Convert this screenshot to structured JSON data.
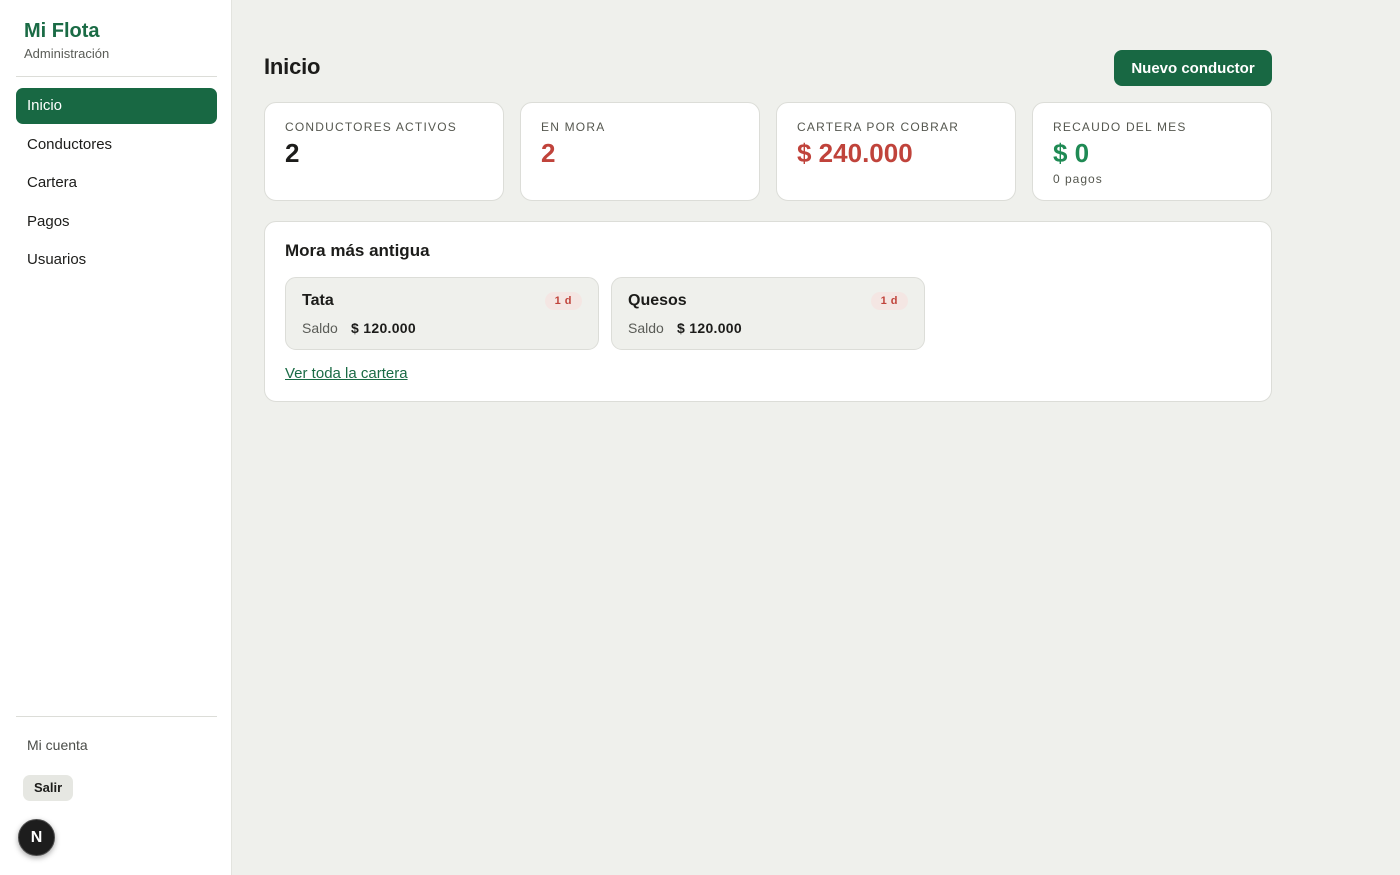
{
  "sidebar": {
    "brand_title": "Mi Flota",
    "brand_subtitle": "Administración",
    "items": [
      {
        "label": "Inicio",
        "active": true
      },
      {
        "label": "Conductores",
        "active": false
      },
      {
        "label": "Cartera",
        "active": false
      },
      {
        "label": "Pagos",
        "active": false
      },
      {
        "label": "Usuarios",
        "active": false
      }
    ],
    "account_label": "Mi cuenta",
    "logout_label": "Salir",
    "badge_letter": "N"
  },
  "header": {
    "title": "Inicio",
    "new_button_label": "Nuevo conductor"
  },
  "stats": [
    {
      "label": "CONDUCTORES ACTIVOS",
      "value": "2",
      "tone": "dark"
    },
    {
      "label": "EN MORA",
      "value": "2",
      "tone": "red"
    },
    {
      "label": "CARTERA POR COBRAR",
      "value": "$ 240.000",
      "tone": "red"
    },
    {
      "label": "RECAUDO DEL MES",
      "value": "$ 0",
      "sub": "0 pagos",
      "tone": "green"
    }
  ],
  "mora_panel": {
    "title": "Mora más antigua",
    "items": [
      {
        "name": "Tata",
        "days": "1 d",
        "balance_label": "Saldo",
        "balance": "$ 120.000"
      },
      {
        "name": "Quesos",
        "days": "1 d",
        "balance_label": "Saldo",
        "balance": "$ 120.000"
      }
    ],
    "link_label": "Ver toda la cartera"
  },
  "colors": {
    "accent": "#186843",
    "danger": "#c0433b",
    "success": "#1f8a54",
    "background": "#eff0ec"
  }
}
